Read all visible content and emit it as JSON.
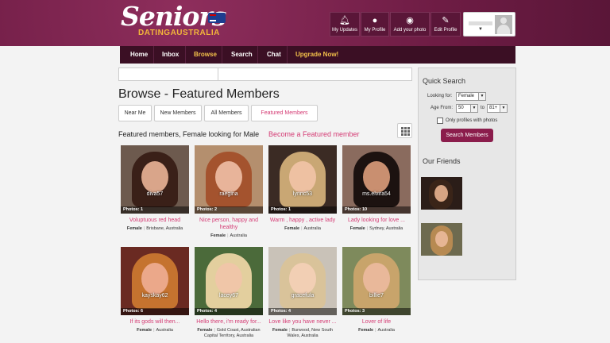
{
  "brand": {
    "logo_main": "Seniors",
    "logo_sub": "DATINGAUSTRALIA"
  },
  "toolbar": [
    {
      "label": "My Updates",
      "icon": "bell-icon"
    },
    {
      "label": "My Profile",
      "icon": "person-icon"
    },
    {
      "label": "Add your photo",
      "icon": "camera-icon"
    },
    {
      "label": "Edit Profile",
      "icon": "pencil-icon"
    }
  ],
  "nav": {
    "items": [
      "Home",
      "Inbox",
      "Browse",
      "Search",
      "Chat",
      "Upgrade Now!"
    ],
    "active": "Browse"
  },
  "page": {
    "title": "Browse - Featured Members",
    "tabs": [
      "Near Me",
      "New Members",
      "All Members",
      "Featured Members"
    ],
    "active_tab": "Featured Members",
    "section_label": "Featured members, Female looking for Male",
    "become_featured": "Become a Featured member"
  },
  "members": [
    {
      "username": "diva57",
      "photos": "Photos: 1",
      "headline": "Voluptuous red head",
      "gender": "Female",
      "location": "Brisbane, Australia"
    },
    {
      "username": "raegina",
      "photos": "Photos: 2",
      "headline": "Nice person, happy and healthy",
      "gender": "Female",
      "location": "Australia"
    },
    {
      "username": "lynnc53",
      "photos": "Photos: 1",
      "headline": "Warm , happy , active lady",
      "gender": "Female",
      "location": "Australia"
    },
    {
      "username": "ms.elvira54",
      "photos": "Photos: 10",
      "headline": "Lady looking for love ...",
      "gender": "Female",
      "location": "Sydney, Australia"
    },
    {
      "username": "kayskay62",
      "photos": "Photos: 6",
      "headline": "If its gods will then...",
      "gender": "Female",
      "location": "Australia"
    },
    {
      "username": "lacey67",
      "photos": "Photos: 4",
      "headline": "Hello there, i'm ready for...",
      "gender": "Female",
      "location": "Gold Coast, Australian Capital Territory, Australia"
    },
    {
      "username": "gracefula",
      "photos": "Photos: 4",
      "headline": "Love like you have never ...",
      "gender": "Female",
      "location": "Burwood, New South Wales, Australia"
    },
    {
      "username": "billie7",
      "photos": "Photos: 3",
      "headline": "Lover of life",
      "gender": "Female",
      "location": "Australia"
    }
  ],
  "quick_search": {
    "title": "Quick Search",
    "looking_for_label": "Looking for:",
    "looking_for_value": "Female",
    "age_from_label": "Age From:",
    "age_from_value": "50",
    "age_to_label": "to",
    "age_to_value": "81+",
    "photos_only_label": "Only profiles with photos",
    "photos_only_checked": false,
    "button": "Search Members"
  },
  "friends": {
    "title": "Our Friends"
  },
  "colors": {
    "brand": "#6e1c44",
    "nav": "#3b0f24",
    "accent": "#d43a73",
    "highlight": "#f3c14a",
    "button": "#8b1d4c"
  }
}
